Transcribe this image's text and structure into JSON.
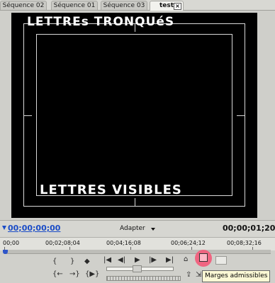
{
  "tabs": [
    {
      "label": "Séquence 02"
    },
    {
      "label": "Séquence 01"
    },
    {
      "label": "Séquence 03"
    },
    {
      "label": "test"
    }
  ],
  "video": {
    "overlay_top": "LETTREs TRONQUéS",
    "overlay_bottom": "LETTRES VISIBLES"
  },
  "timebar": {
    "current_timecode": "00;00;00;00",
    "fit_label": "Adapter",
    "duration_timecode": "00;00;01;20"
  },
  "ruler": {
    "labels": [
      "00;00",
      "00;02;08;04",
      "00;04;16;08",
      "00;06;24;12",
      "00;08;32;16"
    ]
  },
  "tooltip": {
    "text": "Marges admissibles"
  }
}
